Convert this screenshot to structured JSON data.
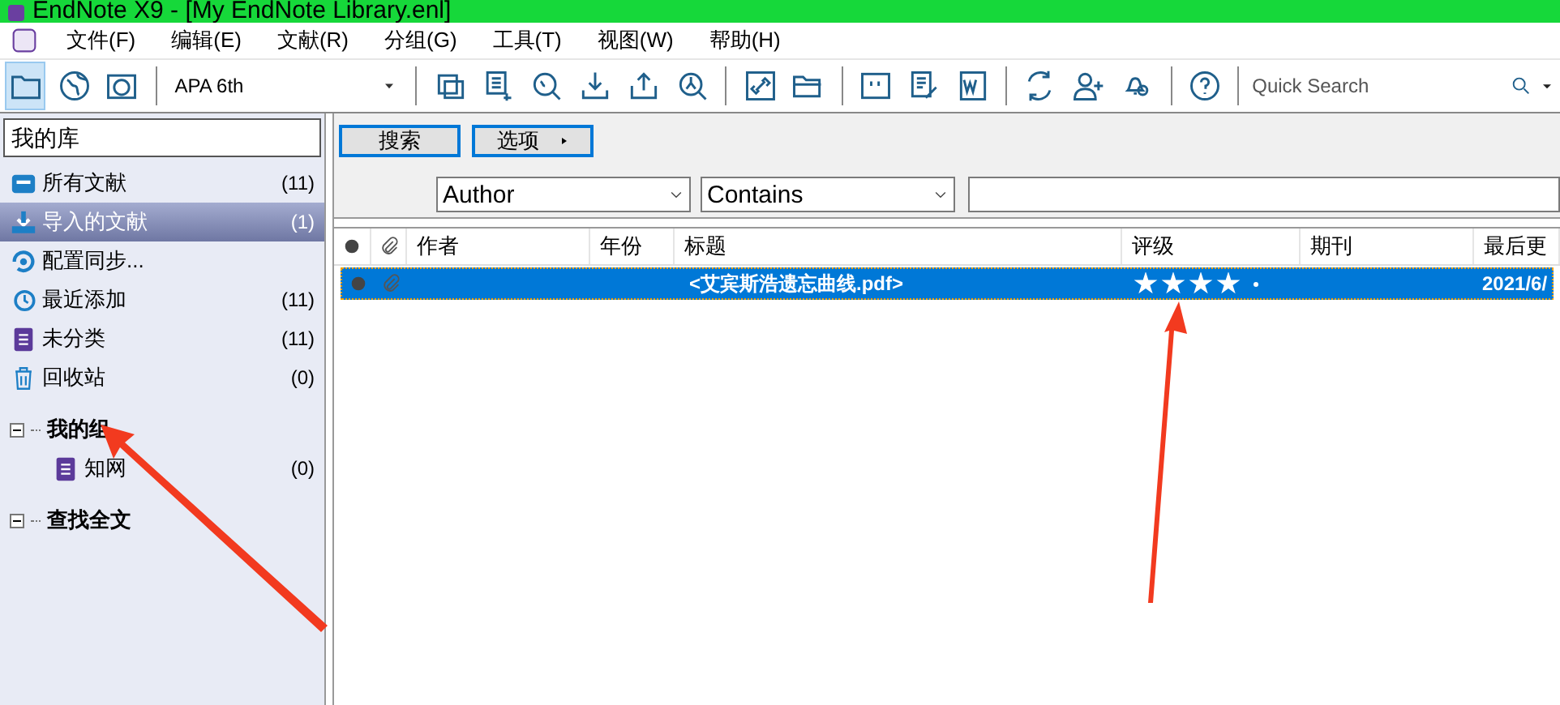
{
  "window": {
    "title": "EndNote X9 - [My EndNote Library.enl]"
  },
  "menu": [
    "文件(F)",
    "编辑(E)",
    "文献(R)",
    "分组(G)",
    "工具(T)",
    "视图(W)",
    "帮助(H)"
  ],
  "toolbar": {
    "style": "APA 6th",
    "quick_search_placeholder": "Quick Search"
  },
  "library": {
    "title": "我的库",
    "items": [
      {
        "label": "所有文献",
        "count": "(11)",
        "selected": false
      },
      {
        "label": "导入的文献",
        "count": "(1)",
        "selected": true
      },
      {
        "label": "配置同步...",
        "selected": false
      },
      {
        "label": "最近添加",
        "count": "(11)",
        "selected": false
      },
      {
        "label": "未分类",
        "count": "(11)",
        "selected": false
      },
      {
        "label": "回收站",
        "count": "(0)",
        "selected": false
      }
    ],
    "groups": [
      {
        "label": "我的组",
        "expanded": true,
        "children": [
          {
            "label": "知网",
            "count": "(0)"
          }
        ]
      },
      {
        "label": "查找全文",
        "expanded": true
      }
    ]
  },
  "search": {
    "buttons": [
      "搜索",
      "选项"
    ],
    "field": "Author",
    "operator": "Contains"
  },
  "table": {
    "columns": [
      "作者",
      "年份",
      "标题",
      "评级",
      "期刊",
      "最后更"
    ],
    "rows": [
      {
        "selected": true,
        "author": "",
        "year": "",
        "title": "<艾宾斯浩遗忘曲线.pdf>",
        "stars": 4,
        "journal": "",
        "updated": "2021/6/"
      }
    ]
  }
}
